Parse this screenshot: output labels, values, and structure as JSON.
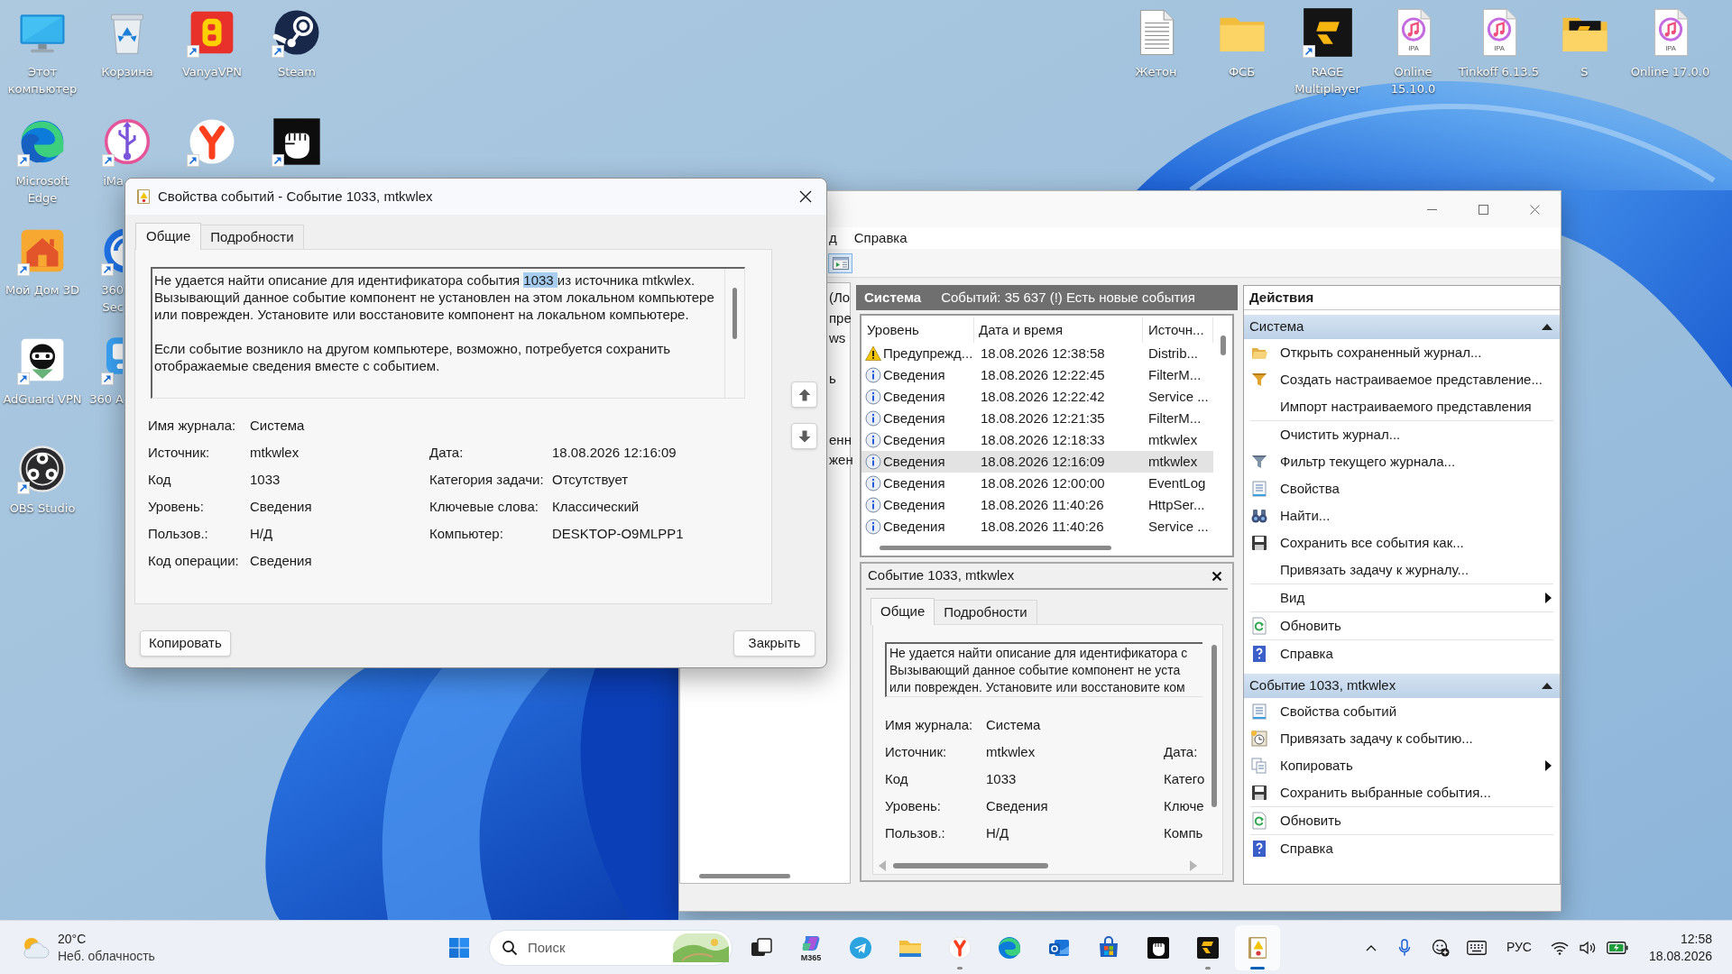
{
  "desktop": {
    "left_columns": [
      [
        {
          "kind": "monitor",
          "label": "Этот компьютер",
          "shortcut": false
        },
        {
          "kind": "edge",
          "label": "Microsoft Edge",
          "shortcut": true
        },
        {
          "kind": "house",
          "label": "Мой Дом 3D",
          "shortcut": true
        },
        {
          "kind": "ninja",
          "label": "AdGuard VPN",
          "shortcut": true
        },
        {
          "kind": "obs",
          "label": "OBS Studio",
          "shortcut": true
        }
      ],
      [
        {
          "kind": "bin",
          "label": "Корзина",
          "shortcut": false
        },
        {
          "kind": "usb",
          "label": "iMa",
          "shortcut": true
        },
        {
          "kind": "ring",
          "label": "360 Sec",
          "shortcut": true
        },
        {
          "kind": "tile",
          "label": "360 A",
          "shortcut": true
        }
      ],
      [
        {
          "kind": "vpn",
          "label": "VanyaVPN",
          "shortcut": true
        },
        {
          "kind": "yandex",
          "shortcut": true
        }
      ],
      [
        {
          "kind": "steam",
          "label": "Steam",
          "shortcut": true
        },
        {
          "kind": "fist",
          "shortcut": true
        }
      ]
    ],
    "right_icons": [
      {
        "kind": "document",
        "label": "Жетон",
        "shortcut": false
      },
      {
        "kind": "folder",
        "label": "ФСБ",
        "shortcut": false
      },
      {
        "kind": "rage",
        "label": "RAGE Multiplayer",
        "shortcut": true
      },
      {
        "kind": "ipa",
        "badge": "IPA",
        "label": "Online 15.10.0",
        "shortcut": false
      },
      {
        "kind": "ipa",
        "badge": "IPA",
        "label": "Tinkoff 6.13.5",
        "shortcut": false
      },
      {
        "kind": "folderapp",
        "label": "S",
        "shortcut": false
      },
      {
        "kind": "ipa",
        "badge": "IPA",
        "label": "Online 17.0.0",
        "shortcut": false
      }
    ]
  },
  "dialog": {
    "title": "Свойства событий - Событие 1033, mtkwlex",
    "tabs": [
      {
        "label": "Общие",
        "selected": true
      },
      {
        "label": "Подробности",
        "selected": false
      }
    ],
    "description": [
      {
        "lines": [
          [
            {
              "text": "Не удается найти описание для идентификатора события ",
              "selected": false
            },
            {
              "text": "1033 ",
              "selected": true
            },
            {
              "text": "из источника mtkwlex.",
              "selected": false
            }
          ],
          [
            {
              "text": "Вызывающий данное событие компонент не установлен на этом локальном компьютере",
              "selected": false
            }
          ],
          [
            {
              "text": "или поврежден. Установите или восстановите компонент на локальном компьютере.",
              "selected": false
            }
          ]
        ]
      },
      {
        "lines": [
          [
            {
              "text": "Если событие возникло на другом компьютере, возможно, потребуется сохранить",
              "selected": false
            }
          ],
          [
            {
              "text": "отображаемые сведения вместе с событием.",
              "selected": false
            }
          ]
        ]
      }
    ],
    "rows": [
      {
        "cells": [
          {
            "label": "Имя журнала:",
            "value": "Система"
          }
        ]
      },
      {
        "cells": [
          {
            "label": "Источник:",
            "value": "mtkwlex"
          },
          {
            "label": "Дата:",
            "value": "18.08.2026 12:16:09"
          }
        ]
      },
      {
        "cells": [
          {
            "label": "Код",
            "value": "1033"
          },
          {
            "label": "Категория задачи:",
            "value": "Отсутствует"
          }
        ]
      },
      {
        "cells": [
          {
            "label": "Уровень:",
            "value": "Сведения"
          },
          {
            "label": "Ключевые слова:",
            "value": "Классический"
          }
        ]
      },
      {
        "cells": [
          {
            "label": "Пользов.:",
            "value": "Н/Д"
          },
          {
            "label": "Компьютер:",
            "value": "DESKTOP-O9MLPP1"
          }
        ]
      },
      {
        "cells": [
          {
            "label": "Код операции:",
            "value": "Сведения"
          }
        ]
      }
    ],
    "buttons": [
      {
        "label": "Копировать"
      },
      {
        "label": "Закрыть"
      }
    ]
  },
  "event_viewer": {
    "menu": [
      {
        "label": "д"
      },
      {
        "label": "Справка"
      }
    ],
    "tree": [
      {
        "label": "(Ло"
      },
      {
        "label": "пре"
      },
      {
        "label": "ws"
      },
      {
        "label": "ь"
      },
      {
        "label": "енн"
      },
      {
        "label": "жен"
      }
    ],
    "log": {
      "name": "Система",
      "summary": "Событий: 35 637 (!) Есть новые события"
    },
    "events": {
      "columns": [
        "Уровень",
        "Дата и время",
        "Источн..."
      ],
      "rows": [
        {
          "kind": "warning",
          "level": "Предупрежд...",
          "datetime": "18.08.2026 12:38:58",
          "source": "Distrib...",
          "selected": false
        },
        {
          "kind": "info",
          "level": "Сведения",
          "datetime": "18.08.2026 12:22:45",
          "source": "FilterM...",
          "selected": false
        },
        {
          "kind": "info",
          "level": "Сведения",
          "datetime": "18.08.2026 12:22:42",
          "source": "Service ...",
          "selected": false
        },
        {
          "kind": "info",
          "level": "Сведения",
          "datetime": "18.08.2026 12:21:35",
          "source": "FilterM...",
          "selected": false
        },
        {
          "kind": "info",
          "level": "Сведения",
          "datetime": "18.08.2026 12:18:33",
          "source": "mtkwlex",
          "selected": false
        },
        {
          "kind": "info",
          "level": "Сведения",
          "datetime": "18.08.2026 12:16:09",
          "source": "mtkwlex",
          "selected": true
        },
        {
          "kind": "info",
          "level": "Сведения",
          "datetime": "18.08.2026 12:00:00",
          "source": "EventLog",
          "selected": false
        },
        {
          "kind": "info",
          "level": "Сведения",
          "datetime": "18.08.2026 11:40:26",
          "source": "HttpSer...",
          "selected": false
        },
        {
          "kind": "info",
          "level": "Сведения",
          "datetime": "18.08.2026 11:40:26",
          "source": "Service ...",
          "selected": false
        }
      ]
    },
    "preview": {
      "title": "Событие 1033, mtkwlex",
      "tabs": [
        {
          "label": "Общие",
          "selected": true
        },
        {
          "label": "Подробности",
          "selected": false
        }
      ],
      "description_lines": [
        "Не удается найти описание для идентификатора с",
        "Вызывающий данное событие компонент не уста",
        "или поврежден. Установите или восстановите ком"
      ],
      "rows": [
        {
          "cells": [
            {
              "label": "Имя журнала:",
              "value": "Система"
            }
          ]
        },
        {
          "cells": [
            {
              "label": "Источник:",
              "value": "mtkwlex"
            },
            {
              "label": "Дата:"
            }
          ]
        },
        {
          "cells": [
            {
              "label": "Код",
              "value": "1033"
            },
            {
              "label": "Катего"
            }
          ]
        },
        {
          "cells": [
            {
              "label": "Уровень:",
              "value": "Сведения"
            },
            {
              "label": "Ключе"
            }
          ]
        },
        {
          "cells": [
            {
              "label": "Пользов.:",
              "value": "Н/Д"
            },
            {
              "label": "Компь"
            }
          ]
        }
      ]
    },
    "actions": {
      "title": "Действия",
      "sections": [
        {
          "title": "Система",
          "expanded": true,
          "groups": [
            [
              {
                "kind": "folder",
                "label": "Открыть сохраненный журнал...",
                "submenu": false
              },
              {
                "kind": "funnel",
                "label": "Создать настраиваемое представление...",
                "submenu": false
              },
              {
                "kind": "none",
                "label": "Импорт настраиваемого представления",
                "submenu": false
              }
            ],
            [
              {
                "kind": "none",
                "label": "Очистить журнал...",
                "submenu": false
              },
              {
                "kind": "filter",
                "label": "Фильтр текущего журнала...",
                "submenu": false
              },
              {
                "kind": "sheet",
                "label": "Свойства",
                "submenu": false
              },
              {
                "kind": "binoculars",
                "label": "Найти...",
                "submenu": false
              },
              {
                "kind": "disk",
                "label": "Сохранить все события как...",
                "submenu": false
              },
              {
                "kind": "none",
                "label": "Привязать задачу к журналу...",
                "submenu": false
              }
            ],
            [
              {
                "kind": "none",
                "label": "Вид",
                "submenu": true
              }
            ],
            [
              {
                "kind": "refresh",
                "label": "Обновить",
                "submenu": false
              }
            ],
            [
              {
                "kind": "help",
                "label": "Справка",
                "submenu": false
              }
            ]
          ]
        },
        {
          "title": "Событие 1033, mtkwlex",
          "expanded": true,
          "groups": [
            [
              {
                "kind": "sheet",
                "label": "Свойства событий",
                "submenu": false
              },
              {
                "kind": "clock",
                "label": "Привязать задачу к событию...",
                "submenu": false
              },
              {
                "kind": "copy",
                "label": "Копировать",
                "submenu": true
              },
              {
                "kind": "disk",
                "label": "Сохранить выбранные события...",
                "submenu": false
              }
            ],
            [
              {
                "kind": "refresh",
                "label": "Обновить",
                "submenu": false
              }
            ],
            [
              {
                "kind": "help",
                "label": "Справка",
                "submenu": false
              }
            ]
          ]
        }
      ]
    }
  },
  "taskbar": {
    "weather": {
      "temperature": "20°C",
      "condition": "Неб. облачность"
    },
    "search": {
      "placeholder": "Поиск"
    },
    "apps": [
      {
        "kind": "taskview",
        "running": false,
        "active": false
      },
      {
        "kind": "m365",
        "badge": "M365",
        "running": false,
        "active": false
      },
      {
        "kind": "telegram",
        "running": false,
        "active": false
      },
      {
        "kind": "explorer",
        "running": false,
        "active": false
      },
      {
        "kind": "yandex",
        "running": true,
        "active": false
      },
      {
        "kind": "edge",
        "running": false,
        "active": false
      },
      {
        "kind": "outlook",
        "running": false,
        "active": false
      },
      {
        "kind": "store",
        "running": false,
        "active": false
      },
      {
        "kind": "fist",
        "running": false,
        "active": false
      },
      {
        "kind": "rage",
        "running": true,
        "active": false
      },
      {
        "kind": "eventlog",
        "running": true,
        "active": true
      }
    ],
    "tray": {
      "language": "РУС",
      "time": "12:58",
      "date": "18.08.2026"
    }
  }
}
